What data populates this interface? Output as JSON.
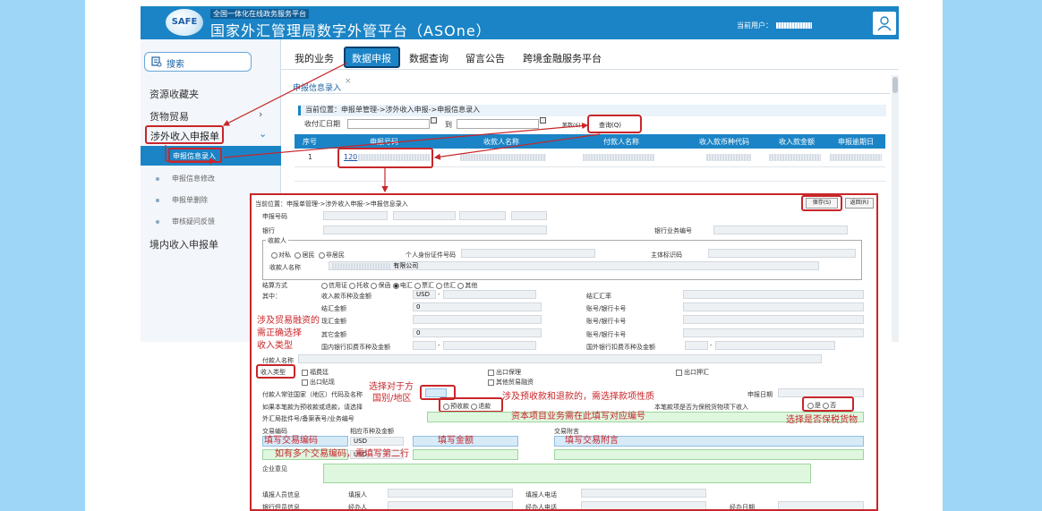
{
  "header": {
    "logo_text": "SAFE",
    "subtitle": "全国一体化在线政务服务平台",
    "title": "国家外汇管理局数字外管平台（ASOne）",
    "user_label": "当前用户："
  },
  "sidebar": {
    "search_label": "搜索",
    "items": [
      {
        "label": "资源收藏夹"
      },
      {
        "label": "货物贸易"
      },
      {
        "label": "涉外收入申报单"
      },
      {
        "label": "境内收入申报单"
      }
    ],
    "sub_items": [
      {
        "label": "申报信息录入"
      },
      {
        "label": "申报信息修改"
      },
      {
        "label": "申报单删除"
      },
      {
        "label": "审核疑问反馈"
      }
    ]
  },
  "tabs": [
    {
      "label": "我的业务"
    },
    {
      "label": "数据申报"
    },
    {
      "label": "数据查询"
    },
    {
      "label": "留言公告"
    },
    {
      "label": "跨境金融服务平台"
    }
  ],
  "page": {
    "tab_label": "申报信息录入",
    "breadcrumb": "当前位置：申报单管理->涉外收入申报->申报信息录入",
    "query": {
      "date_label": "收付汇日期",
      "to_label": "到",
      "count_label": "笔数(S)",
      "button": "查询(Q)"
    },
    "grid": {
      "columns": [
        "序号",
        "申报号码",
        "收款人名称",
        "付款人名称",
        "收入款币种代码",
        "收入款金额",
        "申报逾期日"
      ],
      "rows": [
        {
          "no": "1",
          "code": "120"
        }
      ]
    }
  },
  "dialog": {
    "breadcrumb": "当前位置：申报单管理->涉外收入申报->申报信息录入",
    "save_button": "保存(S)",
    "back_button": "返回(R)",
    "labels": {
      "report_no": "申报号码",
      "bank": "银行",
      "bank_biz_no": "银行业务编号",
      "payee_group": "收款人",
      "personal_id": "个人身份证件号码",
      "entity_code": "主体标识码",
      "payee_name": "收款人名称",
      "company_suffix": "有限公司",
      "settlement": "结算方式",
      "among": "其中：",
      "income_currency": "收入款币种及金额",
      "exchange_rate": "结汇汇率",
      "settle_amount": "结汇金额",
      "spot_amount": "现汇金额",
      "other_amount": "其它金额",
      "account1": "账号/银行卡号",
      "account2": "账号/银行卡号",
      "account3": "账号/银行卡号",
      "domestic_fee": "国内银行扣费币种及金额",
      "foreign_fee": "国外银行扣费币种及金额",
      "payer_name": "付款人名称",
      "income_type": "收入类型",
      "payer_country": "付款人常驻国家（地区）代码及名称",
      "report_date": "申报日期",
      "prepay_q": "如果本笔款为预收款或退款，请选择",
      "bonded_q": "本笔款项是否为保税货物项下收入",
      "registration": "外汇局批件号/备案表号/业务编号",
      "trade_code": "交易编码",
      "currency_amount": "相应币种及金额",
      "trade_note": "交易附言",
      "opinion": "企业意见",
      "filler_info": "填报人员信息",
      "filler": "填报人",
      "filler_phone": "填报人电话",
      "bank_info": "银行但员信息",
      "handler": "经办人",
      "handler_phone": "经办人电话",
      "handle_date": "经办日期"
    },
    "payee_options": [
      "对私",
      "居民",
      "非居民"
    ],
    "settlement_options": [
      "信用证",
      "托收",
      "保函",
      "电汇",
      "票汇",
      "信汇",
      "其他"
    ],
    "income_types": [
      "福费廷",
      "出口保理",
      "出口押汇",
      "出口贴现",
      "其他贸易融资"
    ],
    "prepay_options": [
      "预收款",
      "退款"
    ],
    "bonded_options": [
      "是",
      "否"
    ],
    "values": {
      "currency": "USD",
      "dash": "-",
      "settle": "0",
      "other": "0",
      "trade_currency_1": "USD",
      "trade_currency_2": "USD"
    }
  },
  "annotations": {
    "income_type_note": [
      "涉及贸易融资的",
      "需正确选择",
      "收入类型"
    ],
    "country_note": [
      "选择对于方",
      "国别/地区"
    ],
    "prepay_note": "涉及预收款和退款的，需选择款项性质",
    "capital_note": "资本项目业务需在此填写对应编号",
    "bonded_note": "选择是否保税货物",
    "trade_code_note": "填写交易编码",
    "amount_note": "填写金额",
    "trade_note_hint": "填写交易附言",
    "multi_code_note": "如有多个交易编码，需填写第二行"
  },
  "colors": {
    "brand_blue": "#1b84c6",
    "highlight_red": "#c8262a",
    "background": "#9dd6f7"
  }
}
